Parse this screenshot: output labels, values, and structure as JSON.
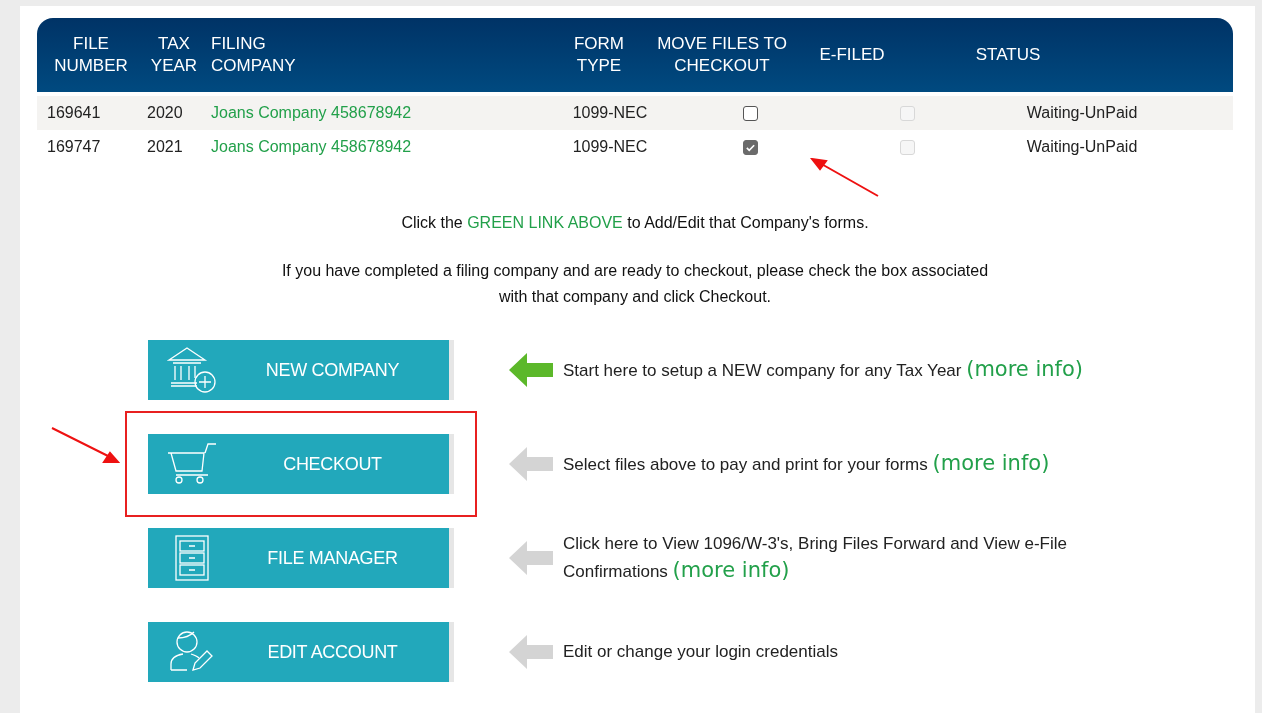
{
  "table": {
    "columns": [
      {
        "label": "FILE NUMBER"
      },
      {
        "label": "TAX YEAR"
      },
      {
        "label": "FILING COMPANY"
      },
      {
        "label": "FORM TYPE"
      },
      {
        "label": "MOVE FILES TO CHECKOUT"
      },
      {
        "label": "E-FILED"
      },
      {
        "label": "STATUS"
      }
    ],
    "rows": [
      {
        "file_number": "169641",
        "tax_year": "2020",
        "company": "Joans Company 458678942",
        "form_type": "1099-NEC",
        "move_to_checkout": false,
        "e_filed": false,
        "status": "Waiting-UnPaid"
      },
      {
        "file_number": "169747",
        "tax_year": "2021",
        "company": "Joans Company 458678942",
        "form_type": "1099-NEC",
        "move_to_checkout": true,
        "e_filed": false,
        "status": "Waiting-UnPaid"
      }
    ]
  },
  "instructions": [
    "Click the **GREEN LINK ABOVE** to Add/Edit that Company's forms.",
    "If you have completed a filing company and are ready to checkout, please check the box associated with that company and click Checkout."
  ],
  "actions": [
    {
      "label": "NEW COMPANY",
      "kind": "bank",
      "description": "Start here to setup a NEW company for any Tax Year",
      "link": "(more info)",
      "active": true,
      "highlighted": false
    },
    {
      "label": "CHECKOUT",
      "kind": "cart",
      "description": "Select files above to pay and print for your forms",
      "link": "(more info)",
      "active": false,
      "highlighted": true
    },
    {
      "label": "FILE MANAGER",
      "kind": "cabinet",
      "description": "Click here to View 1096/W-3's, Bring Files Forward and View e-File Confirmations",
      "link": "(more info)",
      "active": false,
      "highlighted": false
    },
    {
      "label": "EDIT ACCOUNT",
      "kind": "user",
      "description": "Edit or change your login credentials",
      "active": false,
      "highlighted": false
    }
  ]
}
